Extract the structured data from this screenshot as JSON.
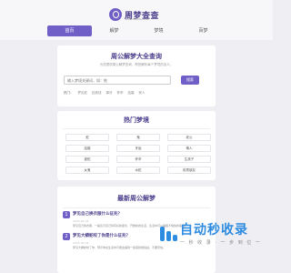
{
  "header": {
    "logo_text": "周梦查查",
    "logo_sub": "ZHOUMENG.COM"
  },
  "nav": {
    "items": [
      "首页",
      "解梦",
      "梦境",
      "百梦"
    ]
  },
  "search_card": {
    "title": "周公解梦大全查询",
    "desc": "为您提供周公解梦查询，帮您解析每个梦境的含义。",
    "input_placeholder": "输入梦境关键词，如：蛇",
    "button_label": "搜索",
    "hot_label": "热门：",
    "hot_terms": [
      "梦见蛇",
      "捡到钱",
      "掉牙",
      "怀孕",
      "结婚",
      "死人"
    ]
  },
  "hot_card": {
    "title": "热门梦境",
    "cells": [
      "蛇",
      "鬼",
      "老公",
      "结婚",
      "牙齿",
      "情人",
      "被蛇",
      "怀孕",
      "生孩子",
      "女鬼",
      "水蛇",
      "前男朋友"
    ]
  },
  "latest_card": {
    "title": "最新周公解梦",
    "posts": [
      {
        "num": "1",
        "title": "梦见自己换衣服什么征兆？",
        "date": "2025-04-04",
        "text": "梦见自己换衣服，一般表示自己将有好的变化，开始新的生活，生活中可以摆脱不愉快的事情。"
      },
      {
        "num": "2",
        "title": "梦见大蟒蛇咬了你是什么征兆？",
        "date": "2025-04-04",
        "text": "梦见大蟒蛇咬了你，预示你在生活中可能会遇到一些麻烦或挑战，不要害怕。"
      }
    ]
  },
  "watermark": {
    "main": "自动秒收录",
    "sub": "一 秒 收 录 · 一 步 到 位 一"
  },
  "colors": {
    "accent": "#6f5fc7",
    "title": "#4a3f8c",
    "watermark": "#2d8be0"
  }
}
